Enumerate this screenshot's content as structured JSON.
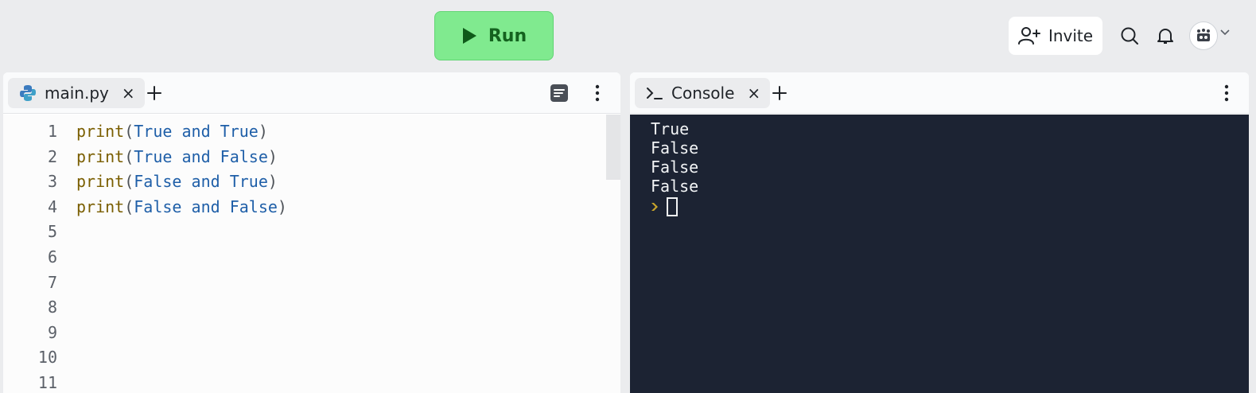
{
  "toolbar": {
    "run_label": "Run",
    "invite_label": "Invite"
  },
  "editor": {
    "tab": {
      "label": "main.py",
      "close": "×"
    },
    "line_numbers": [
      "1",
      "2",
      "3",
      "4",
      "5",
      "6",
      "7",
      "8",
      "9",
      "10",
      "11"
    ],
    "code": [
      {
        "fn": "print",
        "open": "(",
        "a": "True",
        "op": "and",
        "b": "True",
        "close": ")"
      },
      {
        "fn": "print",
        "open": "(",
        "a": "True",
        "op": "and",
        "b": "False",
        "close": ")"
      },
      {
        "fn": "print",
        "open": "(",
        "a": "False",
        "op": "and",
        "b": "True",
        "close": ")"
      },
      {
        "fn": "print",
        "open": "(",
        "a": "False",
        "op": "and",
        "b": "False",
        "close": ")"
      }
    ]
  },
  "console": {
    "tab": {
      "label": "Console",
      "close": "×"
    },
    "output": [
      "True",
      "False",
      "False",
      "False"
    ]
  },
  "colors": {
    "run_bg": "#80ea8f",
    "console_bg": "#1c2333",
    "keyword": "#1f5fa8",
    "function": "#7a5e00"
  },
  "icons": [
    "play-icon",
    "add-user-icon",
    "search-icon",
    "bell-icon",
    "avatar",
    "chevron-down-icon",
    "python-icon",
    "close-icon",
    "plus-icon",
    "format-icon",
    "more-vertical-icon",
    "terminal-icon",
    "prompt-caret-icon"
  ]
}
